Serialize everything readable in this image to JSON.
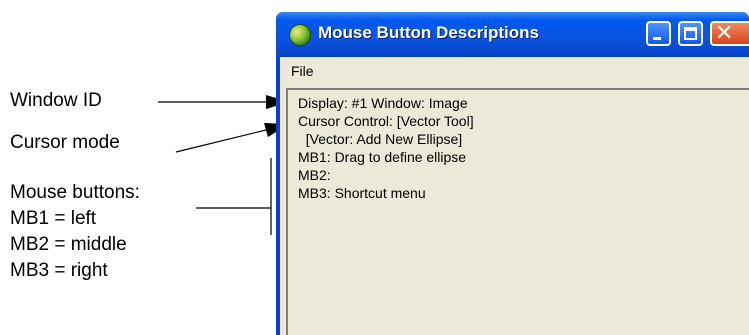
{
  "callouts": {
    "window_id": "Window ID",
    "cursor_mode": "Cursor mode",
    "mouse_buttons": {
      "heading": "Mouse buttons:",
      "mb1": "MB1 = left",
      "mb2": "MB2 = middle",
      "mb3": "MB3 = right"
    }
  },
  "window": {
    "title": "Mouse Button Descriptions",
    "menu": {
      "file": "File"
    },
    "lines": [
      "Display: #1 Window: Image",
      "Cursor Control: [Vector Tool]",
      "  [Vector: Add New Ellipse]",
      "MB1: Drag to define ellipse",
      "MB2:",
      "MB3: Shortcut menu"
    ]
  }
}
